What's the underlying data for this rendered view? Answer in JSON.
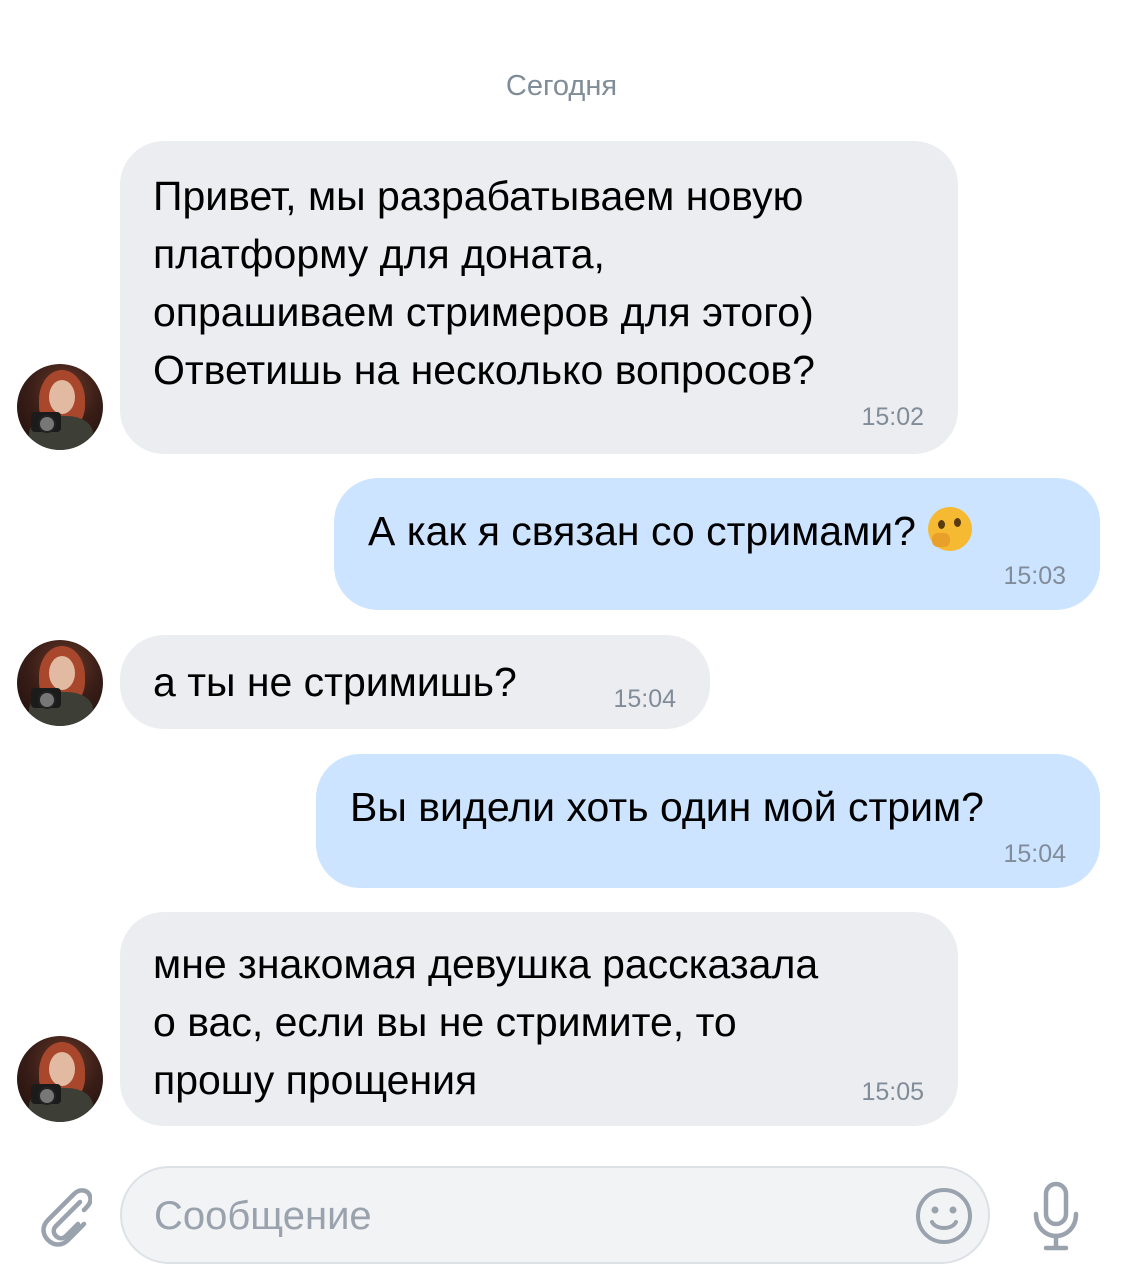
{
  "chat": {
    "date_separator": "Сегодня",
    "messages": [
      {
        "direction": "incoming",
        "text": "Привет, мы разрабатываем новую\nплатформу для доната,\nопрашиваем стримеров для этого)\nОтветишь на несколько вопросов?",
        "time": "15:02"
      },
      {
        "direction": "outgoing",
        "text": "А как я связан со стримами?",
        "emoji": "thinking-face",
        "time": "15:03"
      },
      {
        "direction": "incoming",
        "text": "а ты не стримишь?",
        "time": "15:04"
      },
      {
        "direction": "outgoing",
        "text": "Вы видели хоть один мой стрим?",
        "time": "15:04"
      },
      {
        "direction": "incoming",
        "text": "мне знакомая девушка рассказала\nо вас, если вы не стримите, то\nпрошу прощения",
        "time": "15:05"
      }
    ]
  },
  "composer": {
    "placeholder": "Сообщение",
    "attach_icon": "paperclip-icon",
    "emoji_icon": "smiley-icon",
    "voice_icon": "microphone-icon"
  },
  "colors": {
    "incoming_bubble": "#ebedf0",
    "outgoing_bubble": "#cce4ff",
    "secondary_text": "#818c99",
    "icon_gray": "#99a2ad"
  }
}
